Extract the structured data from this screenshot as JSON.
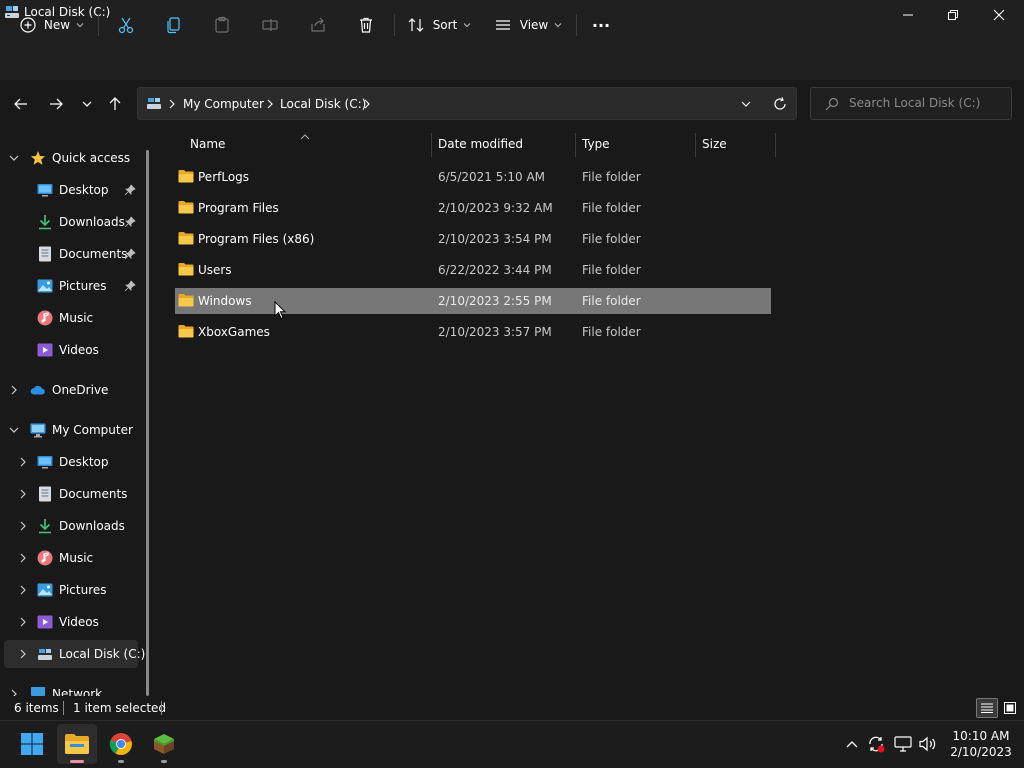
{
  "window": {
    "title": "Local Disk (C:)"
  },
  "toolbar": {
    "new_label": "New",
    "sort_label": "Sort",
    "view_label": "View",
    "more_label": "···"
  },
  "address": {
    "segments": [
      "My Computer",
      "Local Disk (C:)"
    ]
  },
  "search": {
    "placeholder": "Search Local Disk (C:)"
  },
  "sidebar": {
    "quick_access": {
      "label": "Quick access",
      "items": [
        {
          "label": "Desktop",
          "pinned": true
        },
        {
          "label": "Downloads",
          "pinned": true
        },
        {
          "label": "Documents",
          "pinned": true
        },
        {
          "label": "Pictures",
          "pinned": true
        },
        {
          "label": "Music",
          "pinned": false
        },
        {
          "label": "Videos",
          "pinned": false
        }
      ]
    },
    "onedrive": {
      "label": "OneDrive"
    },
    "my_computer": {
      "label": "My Computer",
      "items": [
        {
          "label": "Desktop"
        },
        {
          "label": "Documents"
        },
        {
          "label": "Downloads"
        },
        {
          "label": "Music"
        },
        {
          "label": "Pictures"
        },
        {
          "label": "Videos"
        },
        {
          "label": "Local Disk (C:)"
        }
      ]
    },
    "network": {
      "label": "Network"
    }
  },
  "columns": {
    "name": "Name",
    "date": "Date modified",
    "type": "Type",
    "size": "Size"
  },
  "files": [
    {
      "name": "PerfLogs",
      "date": "6/5/2021 5:10 AM",
      "type": "File folder"
    },
    {
      "name": "Program Files",
      "date": "2/10/2023 9:32 AM",
      "type": "File folder"
    },
    {
      "name": "Program Files (x86)",
      "date": "2/10/2023 3:54 PM",
      "type": "File folder"
    },
    {
      "name": "Users",
      "date": "6/22/2022 3:44 PM",
      "type": "File folder"
    },
    {
      "name": "Windows",
      "date": "2/10/2023 2:55 PM",
      "type": "File folder"
    },
    {
      "name": "XboxGames",
      "date": "2/10/2023 3:57 PM",
      "type": "File folder"
    }
  ],
  "status": {
    "item_count": "6 items",
    "selection": "1 item selected"
  },
  "clock": {
    "time": "10:10 AM",
    "date": "2/10/2023"
  },
  "colors": {
    "folder": "#f7c84a",
    "accent": "#4cc2ff",
    "selection": "#777777"
  }
}
